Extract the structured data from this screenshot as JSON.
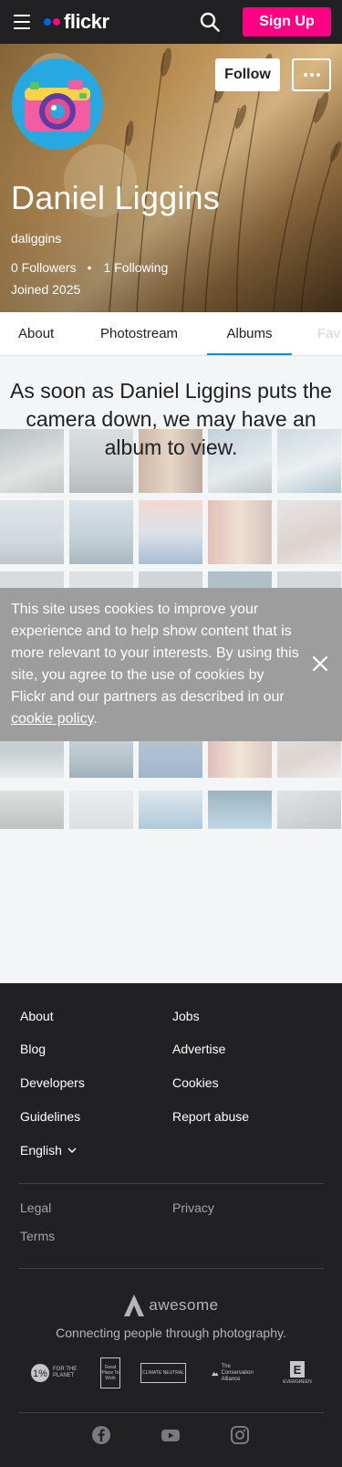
{
  "header": {
    "logo_text": "flickr",
    "signup_label": "Sign Up"
  },
  "profile": {
    "follow_label": "Follow",
    "name": "Daniel Liggins",
    "username": "daliggins",
    "followers": "0 Followers",
    "separator": "•",
    "following": "1 Following",
    "joined": "Joined 2025"
  },
  "tabs": [
    {
      "label": "About"
    },
    {
      "label": "Photostream"
    },
    {
      "label": "Albums"
    },
    {
      "label": "Fav"
    }
  ],
  "empty_state": {
    "message": "As soon as Daniel Liggins puts the camera down, we may have an album to view."
  },
  "cookie_banner": {
    "text": "This site uses cookies to improve your experience and to help show content that is more relevant to your interests. By using this site, you agree to the use of cookies by Flickr and our partners as described in our ",
    "link_text": "cookie policy",
    "suffix": "."
  },
  "footer": {
    "links_left": [
      "About",
      "Blog",
      "Developers",
      "Guidelines"
    ],
    "links_right": [
      "Jobs",
      "Advertise",
      "Cookies",
      "Report abuse"
    ],
    "language": "English",
    "legal": "Legal",
    "privacy": "Privacy",
    "terms": "Terms",
    "brand_word": "awesome",
    "tagline": "Connecting people through photography.",
    "badges": [
      {
        "text": "FOR THE PLANET"
      },
      {
        "text": "Great Place To Work"
      },
      {
        "text": "CLIMATE NEUTRAL"
      },
      {
        "text": "The Conservation Alliance"
      },
      {
        "text": "EVERGREEN"
      }
    ]
  },
  "colors": {
    "topbar": "#212124",
    "brand_pink": "#ff0084",
    "brand_blue": "#0063dc",
    "tab_active": "#128fdc",
    "cookie_bg": "#9d9d9d",
    "footer_bg": "#212124"
  }
}
